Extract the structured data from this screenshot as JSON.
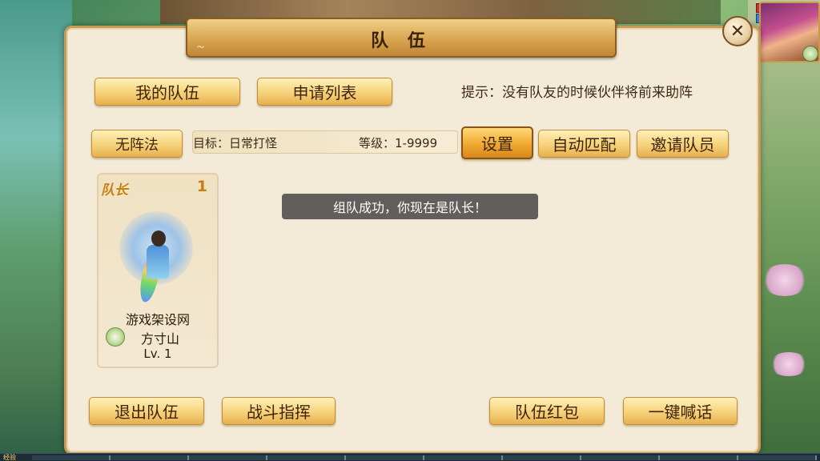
{
  "window": {
    "title": "队 伍"
  },
  "tabs": [
    {
      "label": "我的队伍"
    },
    {
      "label": "申请列表"
    }
  ],
  "hint": "提示：没有队友的时候伙伴将前来助阵",
  "formation_button": "无阵法",
  "target": {
    "label": "目标：日常打怪",
    "level": "等级：1-9999"
  },
  "actions": {
    "settings": "设置",
    "auto_match": "自动匹配",
    "invite": "邀请队员"
  },
  "members": [
    {
      "role": "队长",
      "slot": "1",
      "name": "游戏架设网",
      "sect": "方寸山",
      "level": "Lv. 1"
    }
  ],
  "toast": "组队成功，你现在是队长！",
  "bottom_buttons": {
    "leave": "退出队伍",
    "command": "战斗指挥",
    "red_packet": "队伍红包",
    "shout": "一键喊话"
  },
  "hud": {
    "exp_label": "经验"
  },
  "icons": {
    "close": "close-icon",
    "sect": "sect-icon"
  },
  "colors": {
    "accent": "#f0a92f",
    "panel": "#f3ebd7",
    "leader": "#c87d10"
  }
}
